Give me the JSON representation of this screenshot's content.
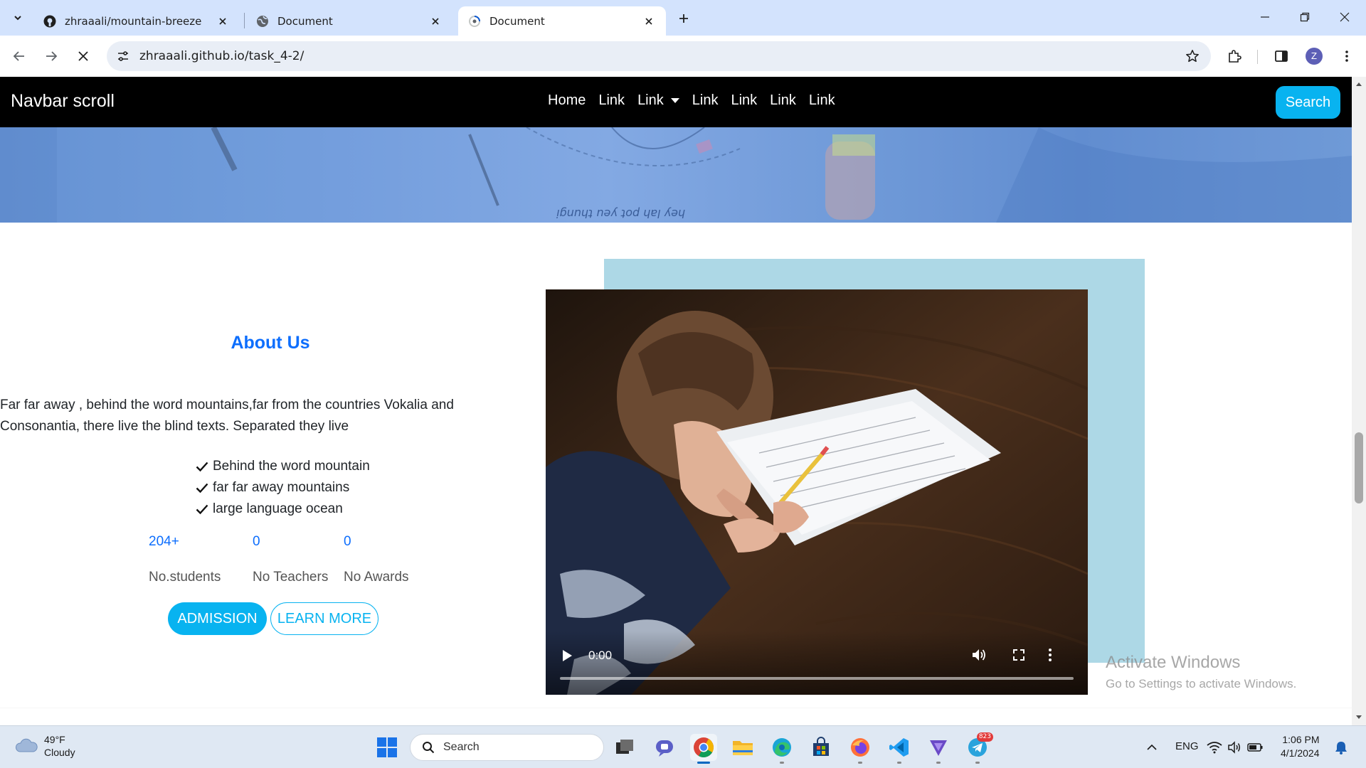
{
  "browser": {
    "tabs": [
      {
        "title": "zhraaali/mountain-breeze",
        "icon": "github-icon",
        "active": false
      },
      {
        "title": "Document",
        "icon": "globe-icon",
        "active": false
      },
      {
        "title": "Document",
        "icon": "loading-icon",
        "active": true
      }
    ],
    "address": "zhraaali.github.io/task_4-2/",
    "profile_initial": "Z"
  },
  "site": {
    "brand": "Navbar scroll",
    "nav": {
      "home": "Home",
      "link1": "Link",
      "link2": "Link",
      "link3": "Link",
      "link4": "Link",
      "link5": "Link",
      "link6": "Link"
    },
    "search_button": "Search",
    "hero_caption": "hey lah pot yeu thungi",
    "about": {
      "title": "About Us",
      "text": "Far far away , behind the word mountains,far from the countries Vokalia and Consonantia, there live the blind texts. Separated they live",
      "checks": [
        "Behind the word mountain",
        "far far away mountains",
        "large language ocean"
      ],
      "stats": [
        {
          "value": "204+",
          "label": "No.students"
        },
        {
          "value": "0",
          "label": "No Teachers"
        },
        {
          "value": "0",
          "label": "No Awards"
        }
      ],
      "admission_button": "ADMISSION",
      "learn_more_button": "LEARN MORE"
    },
    "video": {
      "time": "0:00",
      "progress": 0
    }
  },
  "watermark": {
    "line1": "Activate Windows",
    "line2": "Go to Settings to activate Windows."
  },
  "taskbar": {
    "weather_temp": "49°F",
    "weather_desc": "Cloudy",
    "search_placeholder": "Search",
    "telegram_badge": "823",
    "language": "ENG",
    "time": "1:06 PM",
    "date": "4/1/2024"
  },
  "colors": {
    "accent": "#08b3f0",
    "link_blue": "#0d6efd",
    "video_backdrop": "#add8e6",
    "navbar": "#000000"
  }
}
